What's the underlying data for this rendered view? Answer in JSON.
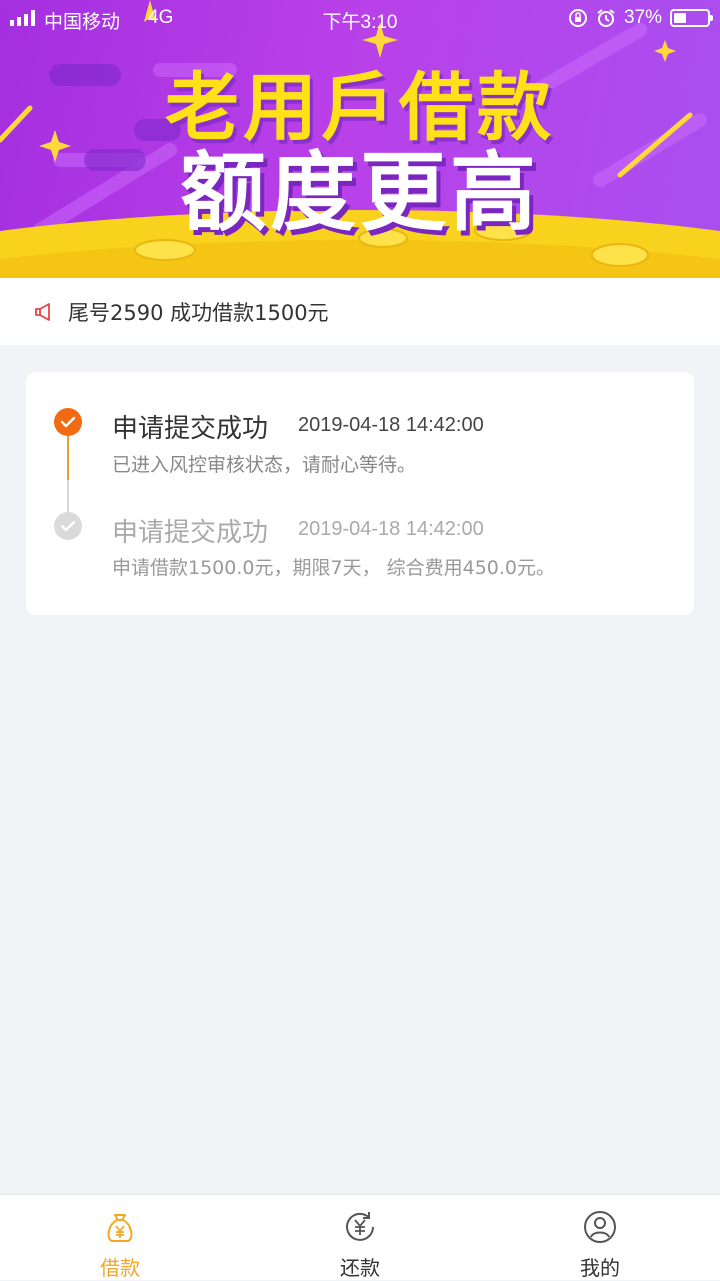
{
  "status_bar": {
    "carrier": "中国移动",
    "network": "4G",
    "time": "下午3:10",
    "battery": "37%"
  },
  "banner": {
    "line1": "老用戶借款",
    "line2": "额度更高"
  },
  "notice": {
    "icon": "megaphone-icon",
    "text": "尾号2590 成功借款1500元"
  },
  "steps": [
    {
      "title": "申请提交成功",
      "date": "2019-04-18 14:42:00",
      "desc": "已进入风控审核状态，请耐心等待。",
      "state": "active"
    },
    {
      "title": "申请提交成功",
      "date": "2019-04-18 14:42:00",
      "desc": "申请借款1500.0元，期限7天， 综合费用450.0元。",
      "state": "done"
    }
  ],
  "tabs": [
    {
      "label": "借款",
      "icon": "money-bag-icon",
      "active": true
    },
    {
      "label": "还款",
      "icon": "repay-icon",
      "active": false
    },
    {
      "label": "我的",
      "icon": "user-icon",
      "active": false
    }
  ],
  "colors": {
    "accent": "#f26a12",
    "tab_active": "#f5a623",
    "banner_purple": "#a42fe0",
    "banner_yellow": "#ffe11a"
  }
}
